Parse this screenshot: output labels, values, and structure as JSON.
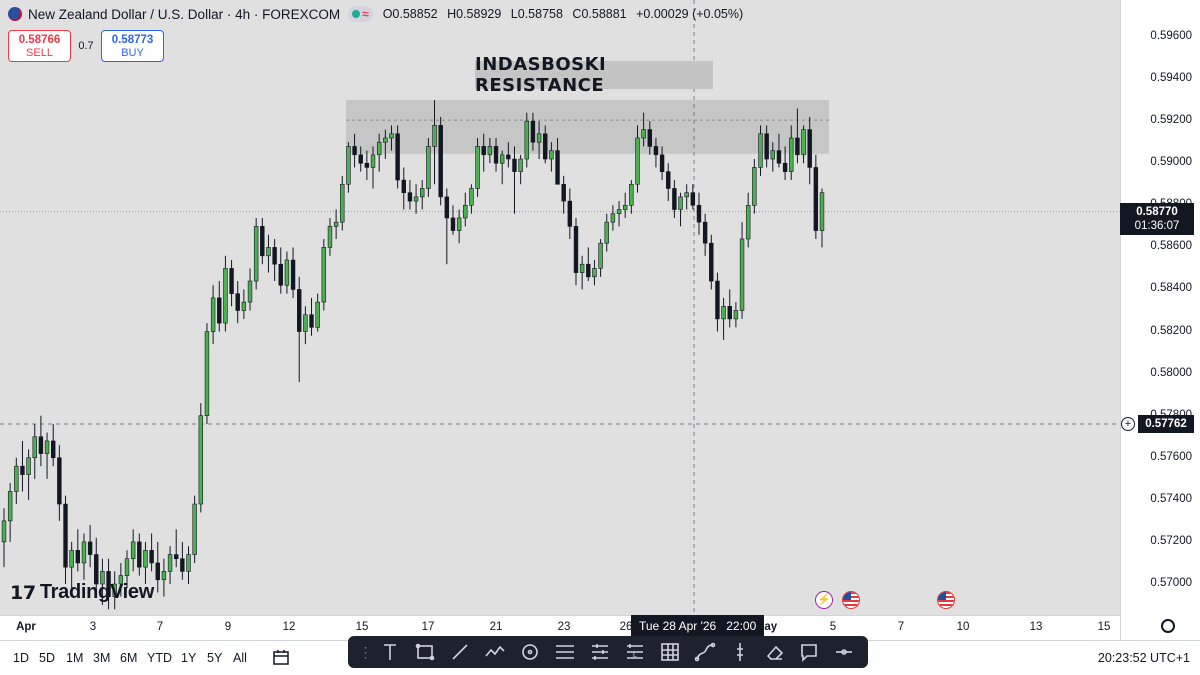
{
  "header": {
    "title": "New Zealand Dollar / U.S. Dollar · 4h · FOREXCOM",
    "ohlc": {
      "open_label": "O",
      "open": "0.58852",
      "high_label": "H",
      "high": "0.58929",
      "low_label": "L",
      "low": "0.58758",
      "close_label": "C",
      "close": "0.58881",
      "change": "+0.00029 (+0.05%)"
    },
    "status_icons": [
      "market-open-icon",
      "wave-icon"
    ]
  },
  "trade": {
    "sell_price": "0.58766",
    "sell_label": "SELL",
    "spread": "0.7",
    "buy_price": "0.58773",
    "buy_label": "BUY"
  },
  "annotation": {
    "resistance_label": "INDASBOSKI RESISTANCE",
    "zone_price_low": 0.59045,
    "zone_price_high": 0.593,
    "zone_dash_price": 0.59205
  },
  "price_axis": {
    "ticks": [
      "0.59600",
      "0.59400",
      "0.59200",
      "0.59000",
      "0.58800",
      "0.58600",
      "0.58400",
      "0.58200",
      "0.58000",
      "0.57800",
      "0.57600",
      "0.57400",
      "0.57200",
      "0.57000"
    ],
    "last_price": "0.58770",
    "countdown": "01:36:07",
    "crosshair_price": "0.57762"
  },
  "time_axis": {
    "ticks": [
      "Apr",
      "3",
      "7",
      "9",
      "12",
      "15",
      "17",
      "21",
      "23",
      "26",
      "May",
      "5",
      "7",
      "10",
      "13",
      "15"
    ],
    "tooltip_date": "Tue 28 Apr '26",
    "tooltip_time": "22:00"
  },
  "bottom_bar": {
    "ranges": [
      "1D",
      "5D",
      "1M",
      "3M",
      "6M",
      "YTD",
      "1Y",
      "5Y",
      "All"
    ],
    "clock": "20:23:52 UTC+1"
  },
  "drawing_tools": [
    "text-tool-icon",
    "rectangle-tool-icon",
    "trend-line-icon",
    "path-icon",
    "circle-tool-icon",
    "parallel-channel-icon",
    "fib-retracement-icon",
    "long-position-icon",
    "short-position-icon",
    "gann-box-icon",
    "curve-tool-icon",
    "price-range-icon",
    "eraser-icon",
    "comment-icon",
    "collapse-icon"
  ],
  "brand": {
    "logo_text": "TradingView"
  },
  "colors": {
    "up": "#4caf50",
    "down": "#131722",
    "zone": "#c6c6c6",
    "background": "#e0e0e0",
    "sell": "#f23645",
    "buy": "#2962ff"
  },
  "chart_data": {
    "type": "candlestick",
    "symbol": "NZDUSD",
    "timeframe": "4h",
    "ylim": [
      0.569,
      0.597
    ],
    "x_range": [
      "Apr",
      "May 15"
    ],
    "grid": false,
    "candles": [
      [
        0.572,
        0.5736,
        0.5708,
        0.573
      ],
      [
        0.573,
        0.5748,
        0.572,
        0.5744
      ],
      [
        0.5744,
        0.576,
        0.5738,
        0.5756
      ],
      [
        0.5756,
        0.5768,
        0.5744,
        0.5752
      ],
      [
        0.5752,
        0.5764,
        0.574,
        0.576
      ],
      [
        0.576,
        0.5776,
        0.575,
        0.577
      ],
      [
        0.577,
        0.578,
        0.5756,
        0.5762
      ],
      [
        0.5762,
        0.5772,
        0.575,
        0.5768
      ],
      [
        0.5768,
        0.5776,
        0.5756,
        0.576
      ],
      [
        0.576,
        0.5766,
        0.573,
        0.5738
      ],
      [
        0.5738,
        0.5742,
        0.57,
        0.5708
      ],
      [
        0.5708,
        0.572,
        0.5698,
        0.5716
      ],
      [
        0.5716,
        0.5726,
        0.5706,
        0.571
      ],
      [
        0.571,
        0.5724,
        0.5702,
        0.572
      ],
      [
        0.572,
        0.5728,
        0.5708,
        0.5714
      ],
      [
        0.5714,
        0.5722,
        0.5696,
        0.57
      ],
      [
        0.57,
        0.5712,
        0.569,
        0.5706
      ],
      [
        0.5706,
        0.5712,
        0.5688,
        0.5694
      ],
      [
        0.5694,
        0.5706,
        0.5688,
        0.57
      ],
      [
        0.57,
        0.571,
        0.5694,
        0.5704
      ],
      [
        0.5704,
        0.5716,
        0.5698,
        0.5712
      ],
      [
        0.5712,
        0.5726,
        0.5706,
        0.572
      ],
      [
        0.572,
        0.5724,
        0.5704,
        0.5708
      ],
      [
        0.5708,
        0.572,
        0.57,
        0.5716
      ],
      [
        0.5716,
        0.5724,
        0.5706,
        0.571
      ],
      [
        0.571,
        0.572,
        0.5696,
        0.5702
      ],
      [
        0.5702,
        0.5712,
        0.5694,
        0.5706
      ],
      [
        0.5706,
        0.5718,
        0.57,
        0.5714
      ],
      [
        0.5714,
        0.5726,
        0.5708,
        0.5712
      ],
      [
        0.5712,
        0.572,
        0.5702,
        0.5706
      ],
      [
        0.5706,
        0.5718,
        0.57,
        0.5714
      ],
      [
        0.5714,
        0.5742,
        0.571,
        0.5738
      ],
      [
        0.5738,
        0.5786,
        0.5734,
        0.578
      ],
      [
        0.578,
        0.5824,
        0.5776,
        0.582
      ],
      [
        0.582,
        0.5842,
        0.5814,
        0.5836
      ],
      [
        0.5836,
        0.5844,
        0.582,
        0.5824
      ],
      [
        0.5824,
        0.5856,
        0.582,
        0.585
      ],
      [
        0.585,
        0.5854,
        0.5832,
        0.5838
      ],
      [
        0.5838,
        0.5844,
        0.5824,
        0.583
      ],
      [
        0.583,
        0.584,
        0.5826,
        0.5834
      ],
      [
        0.5834,
        0.585,
        0.583,
        0.5844
      ],
      [
        0.5844,
        0.5874,
        0.584,
        0.587
      ],
      [
        0.587,
        0.5874,
        0.5852,
        0.5856
      ],
      [
        0.5856,
        0.5866,
        0.5848,
        0.586
      ],
      [
        0.586,
        0.5864,
        0.5844,
        0.5852
      ],
      [
        0.5852,
        0.586,
        0.5838,
        0.5842
      ],
      [
        0.5842,
        0.5858,
        0.5838,
        0.5854
      ],
      [
        0.5854,
        0.586,
        0.5836,
        0.584
      ],
      [
        0.584,
        0.5846,
        0.5796,
        0.582
      ],
      [
        0.582,
        0.5832,
        0.5814,
        0.5828
      ],
      [
        0.5828,
        0.5836,
        0.5818,
        0.5822
      ],
      [
        0.5822,
        0.5838,
        0.582,
        0.5834
      ],
      [
        0.5834,
        0.5864,
        0.583,
        0.586
      ],
      [
        0.586,
        0.5874,
        0.5856,
        0.587
      ],
      [
        0.587,
        0.5878,
        0.5864,
        0.5872
      ],
      [
        0.5872,
        0.5894,
        0.5868,
        0.589
      ],
      [
        0.589,
        0.591,
        0.5886,
        0.5908
      ],
      [
        0.5908,
        0.5914,
        0.5898,
        0.5904
      ],
      [
        0.5904,
        0.5908,
        0.5896,
        0.59
      ],
      [
        0.59,
        0.5906,
        0.5892,
        0.5898
      ],
      [
        0.5898,
        0.5908,
        0.5888,
        0.5904
      ],
      [
        0.5904,
        0.5914,
        0.5896,
        0.591
      ],
      [
        0.591,
        0.5916,
        0.5902,
        0.5912
      ],
      [
        0.5912,
        0.5918,
        0.5906,
        0.5914
      ],
      [
        0.5914,
        0.5918,
        0.5888,
        0.5892
      ],
      [
        0.5892,
        0.5898,
        0.5878,
        0.5886
      ],
      [
        0.5886,
        0.5892,
        0.5878,
        0.5882
      ],
      [
        0.5882,
        0.589,
        0.5876,
        0.5884
      ],
      [
        0.5884,
        0.5892,
        0.5878,
        0.5888
      ],
      [
        0.5888,
        0.5912,
        0.5884,
        0.5908
      ],
      [
        0.5908,
        0.593,
        0.589,
        0.5918
      ],
      [
        0.5918,
        0.5922,
        0.588,
        0.5884
      ],
      [
        0.5884,
        0.5888,
        0.5852,
        0.5874
      ],
      [
        0.5874,
        0.588,
        0.5866,
        0.5868
      ],
      [
        0.5868,
        0.5878,
        0.5862,
        0.5874
      ],
      [
        0.5874,
        0.5886,
        0.587,
        0.588
      ],
      [
        0.588,
        0.589,
        0.5876,
        0.5888
      ],
      [
        0.5888,
        0.5912,
        0.5884,
        0.5908
      ],
      [
        0.5908,
        0.5914,
        0.5896,
        0.5904
      ],
      [
        0.5904,
        0.5912,
        0.59,
        0.5908
      ],
      [
        0.5908,
        0.5912,
        0.5896,
        0.59
      ],
      [
        0.59,
        0.5906,
        0.589,
        0.5904
      ],
      [
        0.5904,
        0.591,
        0.5898,
        0.5902
      ],
      [
        0.5902,
        0.5908,
        0.5876,
        0.5896
      ],
      [
        0.5896,
        0.5904,
        0.589,
        0.5902
      ],
      [
        0.5902,
        0.5924,
        0.5898,
        0.592
      ],
      [
        0.592,
        0.5924,
        0.5906,
        0.591
      ],
      [
        0.591,
        0.592,
        0.5902,
        0.5914
      ],
      [
        0.5914,
        0.5918,
        0.59,
        0.5902
      ],
      [
        0.5902,
        0.591,
        0.5896,
        0.5906
      ],
      [
        0.5906,
        0.5912,
        0.5896,
        0.589
      ],
      [
        0.589,
        0.5894,
        0.5876,
        0.5882
      ],
      [
        0.5882,
        0.5888,
        0.5864,
        0.587
      ],
      [
        0.587,
        0.5874,
        0.5842,
        0.5848
      ],
      [
        0.5848,
        0.5856,
        0.584,
        0.5852
      ],
      [
        0.5852,
        0.586,
        0.5844,
        0.5846
      ],
      [
        0.5846,
        0.5854,
        0.5842,
        0.585
      ],
      [
        0.585,
        0.5864,
        0.5846,
        0.5862
      ],
      [
        0.5862,
        0.5876,
        0.5858,
        0.5872
      ],
      [
        0.5872,
        0.588,
        0.5868,
        0.5876
      ],
      [
        0.5876,
        0.5882,
        0.587,
        0.5878
      ],
      [
        0.5878,
        0.5886,
        0.5874,
        0.588
      ],
      [
        0.588,
        0.5892,
        0.5876,
        0.589
      ],
      [
        0.589,
        0.5918,
        0.5886,
        0.5912
      ],
      [
        0.5912,
        0.5924,
        0.5908,
        0.5916
      ],
      [
        0.5916,
        0.592,
        0.5904,
        0.5908
      ],
      [
        0.5908,
        0.5912,
        0.5898,
        0.5904
      ],
      [
        0.5904,
        0.5908,
        0.5892,
        0.5896
      ],
      [
        0.5896,
        0.59,
        0.5882,
        0.5888
      ],
      [
        0.5888,
        0.5892,
        0.5874,
        0.5878
      ],
      [
        0.5878,
        0.5886,
        0.587,
        0.5884
      ],
      [
        0.5884,
        0.589,
        0.5878,
        0.5886
      ],
      [
        0.5886,
        0.589,
        0.5878,
        0.588
      ],
      [
        0.588,
        0.5886,
        0.5866,
        0.5872
      ],
      [
        0.5872,
        0.5876,
        0.5856,
        0.5862
      ],
      [
        0.5862,
        0.5866,
        0.584,
        0.5844
      ],
      [
        0.5844,
        0.5848,
        0.582,
        0.5826
      ],
      [
        0.5826,
        0.5836,
        0.5816,
        0.5832
      ],
      [
        0.5832,
        0.584,
        0.5822,
        0.5826
      ],
      [
        0.5826,
        0.5834,
        0.5822,
        0.583
      ],
      [
        0.583,
        0.5872,
        0.5826,
        0.5864
      ],
      [
        0.5864,
        0.5886,
        0.586,
        0.588
      ],
      [
        0.588,
        0.5902,
        0.5876,
        0.5898
      ],
      [
        0.5898,
        0.5918,
        0.5894,
        0.5914
      ],
      [
        0.5914,
        0.5918,
        0.5898,
        0.5902
      ],
      [
        0.5902,
        0.591,
        0.5896,
        0.5906
      ],
      [
        0.5906,
        0.5914,
        0.5898,
        0.59
      ],
      [
        0.59,
        0.5908,
        0.5892,
        0.5896
      ],
      [
        0.5896,
        0.5918,
        0.5892,
        0.5912
      ],
      [
        0.5912,
        0.5926,
        0.59,
        0.5904
      ],
      [
        0.5904,
        0.5918,
        0.59,
        0.5916
      ],
      [
        0.5916,
        0.5922,
        0.589,
        0.5898
      ],
      [
        0.5898,
        0.5904,
        0.5864,
        0.5868
      ],
      [
        0.5868,
        0.5888,
        0.586,
        0.5886
      ]
    ]
  }
}
